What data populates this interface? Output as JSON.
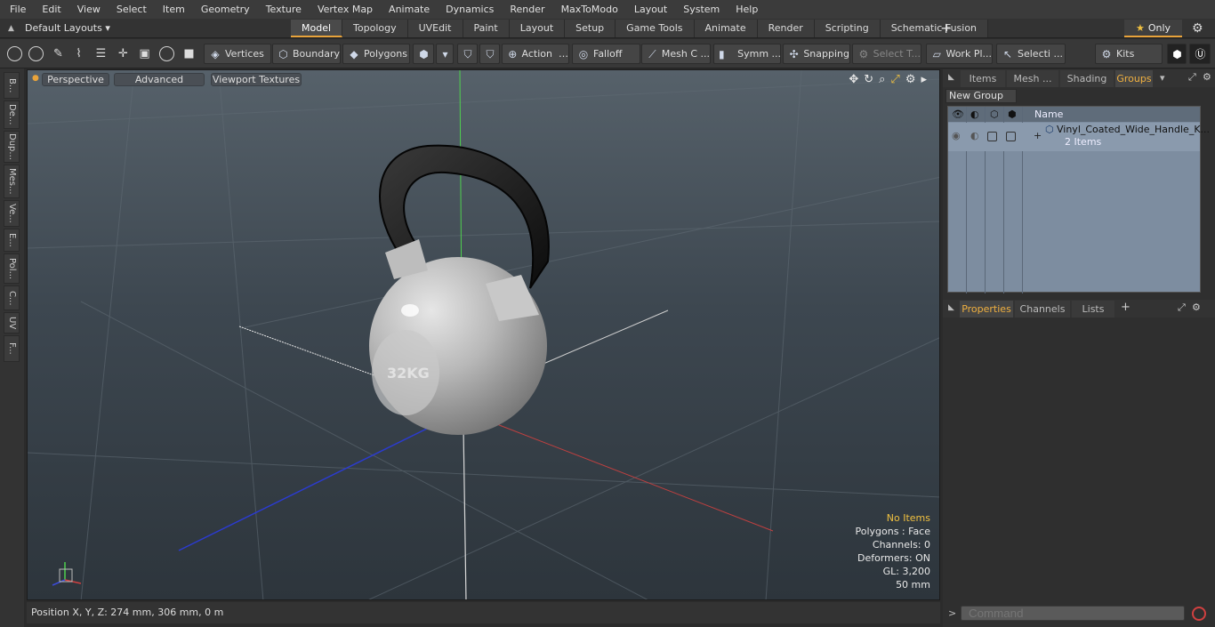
{
  "menu": [
    "File",
    "Edit",
    "View",
    "Select",
    "Item",
    "Geometry",
    "Texture",
    "Vertex Map",
    "Animate",
    "Dynamics",
    "Render",
    "MaxToModo",
    "Layout",
    "System",
    "Help"
  ],
  "layout_dropdown": "Default Layouts",
  "tabs": [
    "Model",
    "Topology",
    "UVEdit",
    "Paint",
    "Layout",
    "Setup",
    "Game Tools",
    "Animate",
    "Render",
    "Scripting",
    "Schematic Fusion"
  ],
  "active_tab": "Model",
  "only_label": "Only",
  "toolbar": {
    "vertices": "Vertices",
    "boundary": "Boundary",
    "polygons": "Polygons",
    "action": "Action",
    "falloff": "Falloff",
    "mesh_c": "Mesh C ...",
    "symm": "Symm ...",
    "snapping": "Snapping",
    "select_t": "Select T...",
    "work_pl": "Work Pl...",
    "selecti": "Selecti ...",
    "kits": "Kits"
  },
  "left_strip": [
    "B...",
    "De...",
    "Dup...",
    "Mes...",
    "Ve...",
    "E...",
    "Pol...",
    "C...",
    "UV",
    "F..."
  ],
  "viewport": {
    "perspective": "Perspective",
    "advanced": "Advanced",
    "textures": "Viewport Textures",
    "info": {
      "no_items": "No Items",
      "polygons": "Polygons : Face",
      "channels": "Channels: 0",
      "deformers": "Deformers: ON",
      "gl": "GL: 3,200",
      "scale": "50 mm"
    },
    "kettlebell_text": "32KG"
  },
  "status": "Position X, Y, Z:   274 mm, 306 mm, 0 m",
  "panel": {
    "tabs": [
      "Items",
      "Mesh ...",
      "Shading",
      "Groups"
    ],
    "active_tab": "Groups",
    "new_group": "New Group",
    "name_header": "Name",
    "group_name": "Vinyl_Coated_Wide_Handle_K...",
    "group_count": "2 Items",
    "prop_tabs": [
      "Properties",
      "Channels",
      "Lists"
    ],
    "command_placeholder": "Command"
  },
  "colors": {
    "accent": "#e8a33b",
    "warn": "#f0c040"
  }
}
